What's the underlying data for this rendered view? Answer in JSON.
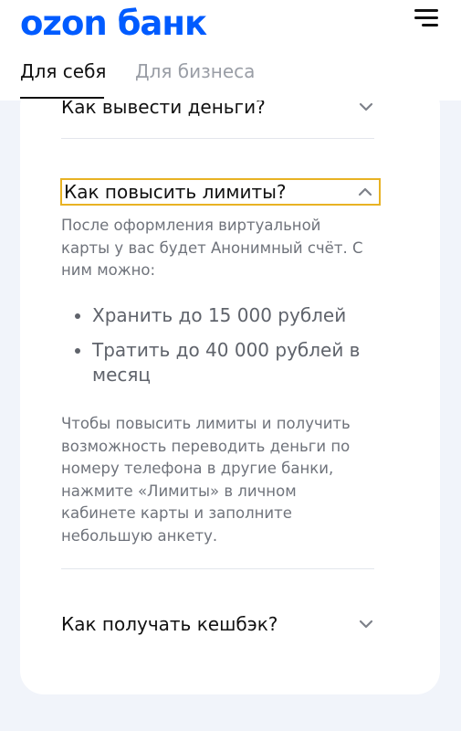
{
  "header": {
    "logo": "ozon банк",
    "menu_icon": "hamburger-menu-icon"
  },
  "tabs": [
    {
      "label": "Для себя",
      "active": true
    },
    {
      "label": "Для бизнеса",
      "active": false
    }
  ],
  "faq": {
    "items": [
      {
        "question": "Как вывести деньги?",
        "expanded": false,
        "icon": "chevron-down-icon"
      },
      {
        "question": "Как повысить лимиты?",
        "expanded": true,
        "icon": "chevron-up-icon"
      },
      {
        "question": "Как получать кешбэк?",
        "expanded": false,
        "icon": "chevron-down-icon"
      }
    ],
    "answer": {
      "intro": "После оформления виртуальной карты у вас будет Анонимный счёт. С ним можно:",
      "bullets": [
        "Хранить до 15 000 рублей",
        "Тратить до 40 000 рублей в месяц"
      ],
      "outro": "Чтобы повысить лимиты и получить возможность переводить деньги по номеру телефона в другие банки, нажмите «Лимиты» в личном кабинете карты и заполните небольшую анкету."
    }
  },
  "colors": {
    "brand": "#005bff",
    "page_bg": "#f1f4fa",
    "focus_outline": "#e8b223",
    "muted_text": "#6f737b"
  }
}
